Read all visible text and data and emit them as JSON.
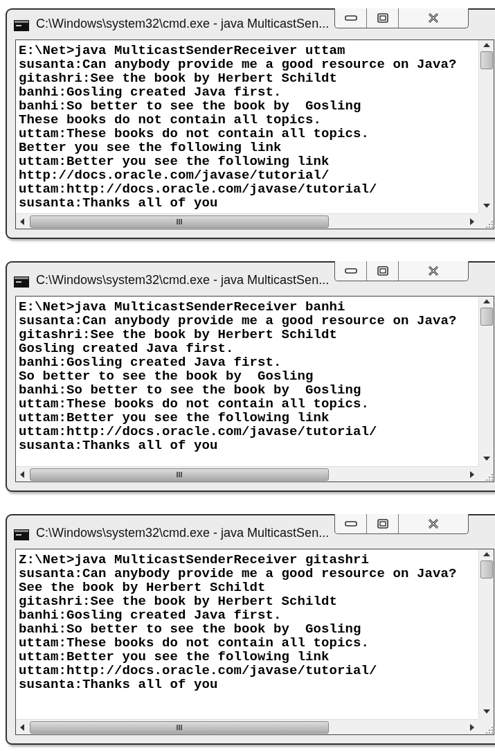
{
  "windows": [
    {
      "title": "C:\\Windows\\system32\\cmd.exe - java  MulticastSen...",
      "lines": [
        "E:\\Net>java MulticastSenderReceiver uttam",
        "susanta:Can anybody provide me a good resource on Java?",
        "gitashri:See the book by Herbert Schildt",
        "banhi:Gosling created Java first.",
        "banhi:So better to see the book by  Gosling",
        "These books do not contain all topics.",
        "uttam:These books do not contain all topics.",
        "Better you see the following link",
        "uttam:Better you see the following link",
        "http://docs.oracle.com/javase/tutorial/",
        "uttam:http://docs.oracle.com/javase/tutorial/",
        "susanta:Thanks all of you"
      ]
    },
    {
      "title": "C:\\Windows\\system32\\cmd.exe - java  MulticastSen...",
      "lines": [
        "E:\\Net>java MulticastSenderReceiver banhi",
        "susanta:Can anybody provide me a good resource on Java?",
        "gitashri:See the book by Herbert Schildt",
        "Gosling created Java first.",
        "banhi:Gosling created Java first.",
        "So better to see the book by  Gosling",
        "banhi:So better to see the book by  Gosling",
        "uttam:These books do not contain all topics.",
        "uttam:Better you see the following link",
        "uttam:http://docs.oracle.com/javase/tutorial/",
        "susanta:Thanks all of you"
      ]
    },
    {
      "title": "C:\\Windows\\system32\\cmd.exe - java  MulticastSen...",
      "lines": [
        "Z:\\Net>java MulticastSenderReceiver gitashri",
        "susanta:Can anybody provide me a good resource on Java?",
        "See the book by Herbert Schildt",
        "gitashri:See the book by Herbert Schildt",
        "banhi:Gosling created Java first.",
        "banhi:So better to see the book by  Gosling",
        "uttam:These books do not contain all topics.",
        "uttam:Better you see the following link",
        "uttam:http://docs.oracle.com/javase/tutorial/",
        "susanta:Thanks all of you"
      ]
    }
  ]
}
